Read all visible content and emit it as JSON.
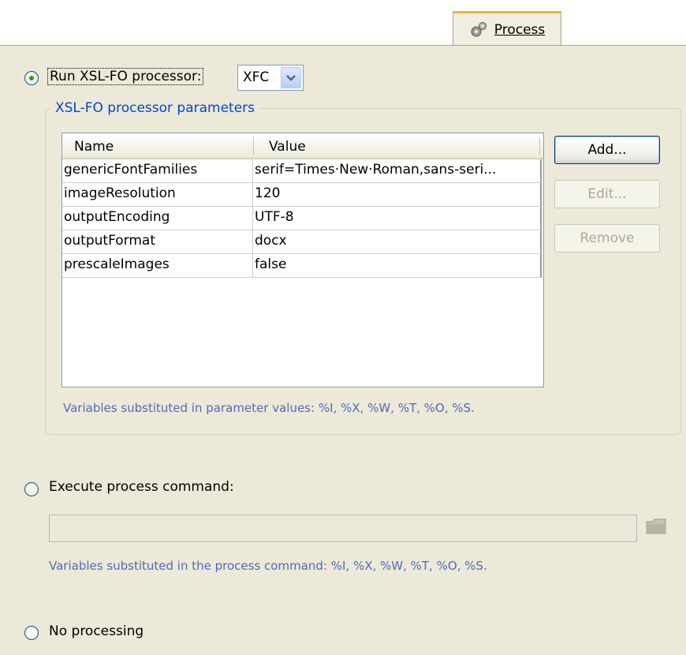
{
  "tab": {
    "label": "Process",
    "icon": "gears-icon"
  },
  "xslfo": {
    "radio_label": "Run XSL-FO processor:",
    "checked": true,
    "processor_selected": "XFC",
    "group_title": "XSL-FO processor parameters",
    "columns": [
      "Name",
      "Value"
    ],
    "rows": [
      {
        "name": "genericFontFamilies",
        "value": "serif=Times·New·Roman,sans-seri..."
      },
      {
        "name": "imageResolution",
        "value": "120"
      },
      {
        "name": "outputEncoding",
        "value": "UTF-8"
      },
      {
        "name": "outputFormat",
        "value": "docx"
      },
      {
        "name": "prescaleImages",
        "value": "false"
      }
    ],
    "buttons": {
      "add": "Add...",
      "edit": "Edit...",
      "remove": "Remove"
    },
    "hint": "Variables substituted in parameter values: %I, %X, %W, %T, %O, %S."
  },
  "command": {
    "radio_label": "Execute process command:",
    "checked": false,
    "input_value": "",
    "browse_icon": "folder-icon",
    "hint": "Variables substituted in the process command: %I, %X, %W, %T, %O, %S."
  },
  "none": {
    "radio_label": "No processing",
    "checked": false
  },
  "colors": {
    "panel": "#ece9d8",
    "tab_accent": "#f2b53a",
    "hint_text": "#4f6bba",
    "group_title": "#0046d5"
  }
}
